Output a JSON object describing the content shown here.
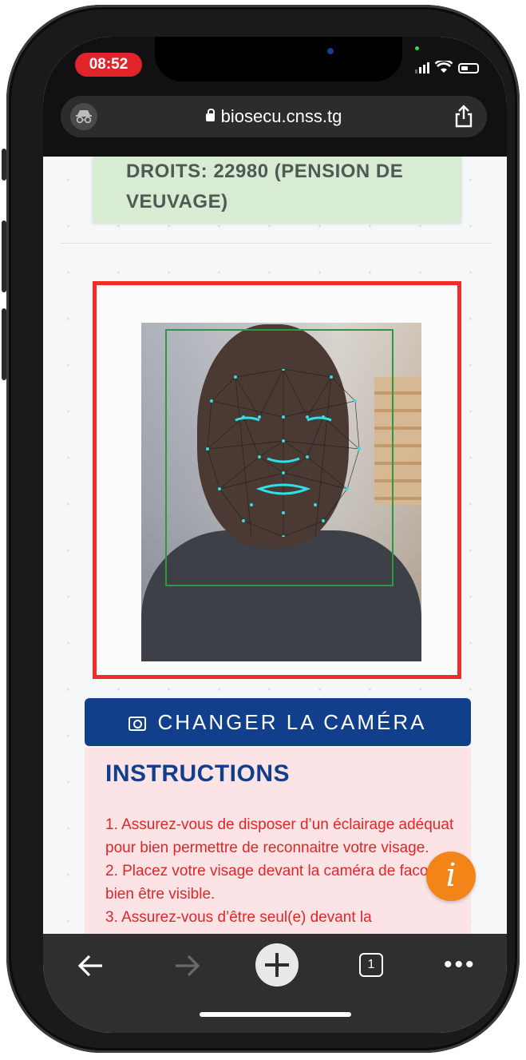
{
  "status_bar": {
    "time": "08:52"
  },
  "browser": {
    "url": "biosecu.cnss.tg",
    "toolbar": {
      "tab_count": "1"
    }
  },
  "page": {
    "droits_text": "DROITS: 22980 (PENSION DE VEUVAGE)",
    "camera_button": "CHANGER LA CAMÉRA",
    "instructions": {
      "title": "INSTRUCTIONS",
      "items": [
        "1. Assurez-vous de disposer d’un éclairage adéquat pour bien permettre de reconnaitre votre visage.",
        "2. Placez votre visage devant la caméra de facon à bien être visible.",
        "3. Assurez-vous d’être seul(e) devant la"
      ]
    },
    "help_fab": "i"
  },
  "colors": {
    "accent_blue": "#123f8c",
    "alert_red": "#e02626",
    "frame_red": "#ef2b2b",
    "fab_orange": "#f38518",
    "mesh_cyan": "#2fe0e6",
    "panel_green": "#d8ecd3"
  }
}
